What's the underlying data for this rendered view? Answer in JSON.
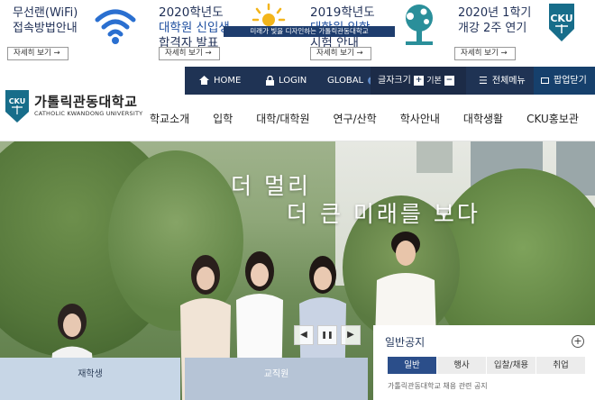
{
  "popups": [
    {
      "title_l1": "무선랜(WiFi)",
      "title_l2": "접속방법안내",
      "more": "자세히 보기 →",
      "icon": "wifi-icon"
    },
    {
      "title_l1": "2020학년도",
      "title_l2": "대학원 신입생",
      "title_l3": "합격자 발표",
      "more": "자세히 보기 →",
      "icon": "sun-icon"
    },
    {
      "title_l1": "2019학년도",
      "title_l2": "대학원 입학",
      "title_l3": "시험 안내",
      "more": "자세히 보기 →",
      "icon": "tree-icon"
    },
    {
      "title_l1": "2020년 1학기",
      "title_l2": "개강 2주 연기",
      "more": "자세히 보기 →",
      "icon": "cku-emblem-icon",
      "emblem_text": "CKU"
    }
  ],
  "ribbon_text": "미래가 빛을 디자인하는 가톨릭관동대학교",
  "util": {
    "home": "HOME",
    "login": "LOGIN",
    "global": "GLOBAL",
    "font_size": "글자크기",
    "font_plus": "+",
    "font_default": "기본",
    "font_minus": "−",
    "all_menu": "전체메뉴",
    "popup_close": "팝업닫기"
  },
  "logo": {
    "emblem_text": "CKU",
    "korean": "가톨릭관동대학교",
    "english": "CATHOLIC KWANDONG UNIVERSITY"
  },
  "gnb": [
    "학교소개",
    "입학",
    "대학/대학원",
    "연구/산학",
    "학사안내",
    "대학생활",
    "CKU홍보관"
  ],
  "hero": {
    "slogan_1": "더 멀리",
    "slogan_2": "더 큰 미래를 보다",
    "prev": "◀",
    "pause": "❚❚",
    "next": "▶"
  },
  "quick_tabs": {
    "students": "재학생",
    "staff": "교직원"
  },
  "notice": {
    "title": "일반공지",
    "plus": "+",
    "tabs": [
      "일반",
      "행사",
      "입찰/채용",
      "취업"
    ],
    "first_line": "가톨릭관동대학교 채용 관련 공지"
  },
  "colors": {
    "navy": "#1f3354",
    "notice_tab_active": "#2b4e8a",
    "students_tab": "#c7d6e6",
    "staff_tab": "#b6c4d6"
  }
}
